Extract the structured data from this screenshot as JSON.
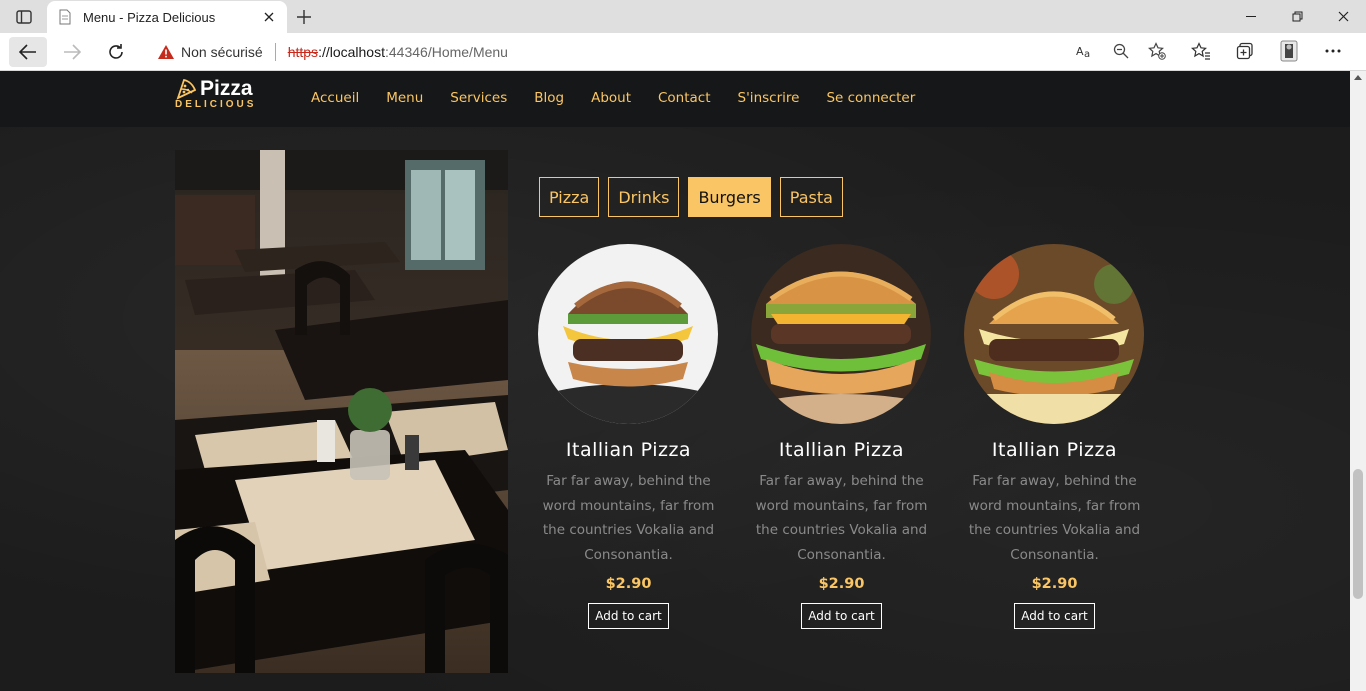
{
  "browser": {
    "tab_title": "Menu - Pizza Delicious",
    "security_label": "Non sécurisé",
    "url_scheme": "https",
    "url_rest": "://localhost",
    "url_path": ":44346/Home/Menu"
  },
  "site": {
    "logo_main": "Pizza",
    "logo_sub": "DELICIOUS",
    "nav": [
      "Accueil",
      "Menu",
      "Services",
      "Blog",
      "About",
      "Contact",
      "S'inscrire",
      "Se connecter"
    ]
  },
  "categories": [
    {
      "label": "Pizza",
      "active": false
    },
    {
      "label": "Drinks",
      "active": false
    },
    {
      "label": "Burgers",
      "active": true
    },
    {
      "label": "Pasta",
      "active": false
    }
  ],
  "items": [
    {
      "name": "Itallian Pizza",
      "desc": "Far far away, behind the word mountains, far from the countries Vokalia and Consonantia.",
      "price": "$2.90",
      "cart": "Add to cart"
    },
    {
      "name": "Itallian Pizza",
      "desc": "Far far away, behind the word mountains, far from the countries Vokalia and Consonantia.",
      "price": "$2.90",
      "cart": "Add to cart"
    },
    {
      "name": "Itallian Pizza",
      "desc": "Far far away, behind the word mountains, far from the countries Vokalia and Consonantia.",
      "price": "$2.90",
      "cart": "Add to cart"
    }
  ],
  "colors": {
    "accent": "#fac564",
    "nav_bg": "#151718",
    "page_bg": "#1c1c1c"
  }
}
